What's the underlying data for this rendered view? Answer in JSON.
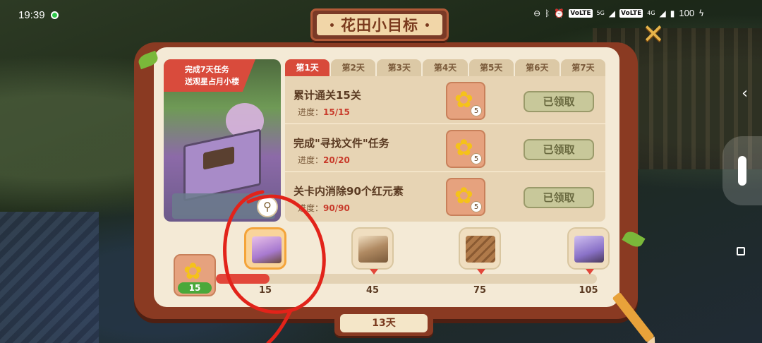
{
  "status_bar": {
    "time": "19:39",
    "net1": "VoLTE",
    "net1_gen": "5G",
    "net2": "VoLTE",
    "net2_gen": "4G",
    "battery": "100"
  },
  "title": "花田小目标",
  "promo": {
    "line1": "完成7天任务",
    "line2": "送观星占月小楼"
  },
  "tabs": [
    {
      "label": "第1天",
      "active": true
    },
    {
      "label": "第2天",
      "active": false
    },
    {
      "label": "第3天",
      "active": false
    },
    {
      "label": "第4天",
      "active": false
    },
    {
      "label": "第5天",
      "active": false
    },
    {
      "label": "第6天",
      "active": false
    },
    {
      "label": "第7天",
      "active": false
    }
  ],
  "tasks": [
    {
      "name": "累计通关15关",
      "progress_label": "进度：",
      "progress": "15/15",
      "reward_count": "5",
      "button": "已领取"
    },
    {
      "name": "完成\"寻找文件\"任务",
      "progress_label": "进度：",
      "progress": "20/20",
      "reward_count": "5",
      "button": "已领取"
    },
    {
      "name": "关卡内消除90个红元素",
      "progress_label": "进度：",
      "progress": "90/90",
      "reward_count": "5",
      "button": "已领取"
    }
  ],
  "progress": {
    "current": "15",
    "max": 105,
    "value": 15,
    "milestones": [
      "15",
      "45",
      "75",
      "105"
    ]
  },
  "days_remaining": "13天",
  "colors": {
    "accent_red": "#d84a3a",
    "claimed_button": "#c8c89a",
    "book_frame": "#8a3a22"
  }
}
